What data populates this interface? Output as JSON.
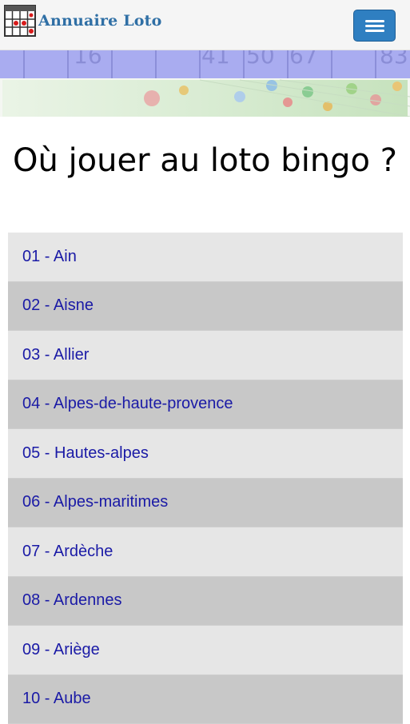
{
  "header": {
    "app_title": "Annuaire Loto",
    "logo_icon": "loto-grid-icon",
    "menu_icon": "hamburger-menu-icon",
    "accent_color": "#2f7fc1"
  },
  "banner": {
    "numbers": [
      "16",
      "41",
      "50",
      "67",
      "83"
    ]
  },
  "page": {
    "title": "Où jouer au loto bingo ?"
  },
  "departments": [
    {
      "label": "01 - Ain"
    },
    {
      "label": "02 - Aisne"
    },
    {
      "label": "03 - Allier"
    },
    {
      "label": "04 - Alpes-de-haute-provence"
    },
    {
      "label": "05 - Hautes-alpes"
    },
    {
      "label": "06 - Alpes-maritimes"
    },
    {
      "label": "07 - Ardèche"
    },
    {
      "label": "08 - Ardennes"
    },
    {
      "label": "09 - Ariège"
    },
    {
      "label": "10 - Aube"
    }
  ]
}
